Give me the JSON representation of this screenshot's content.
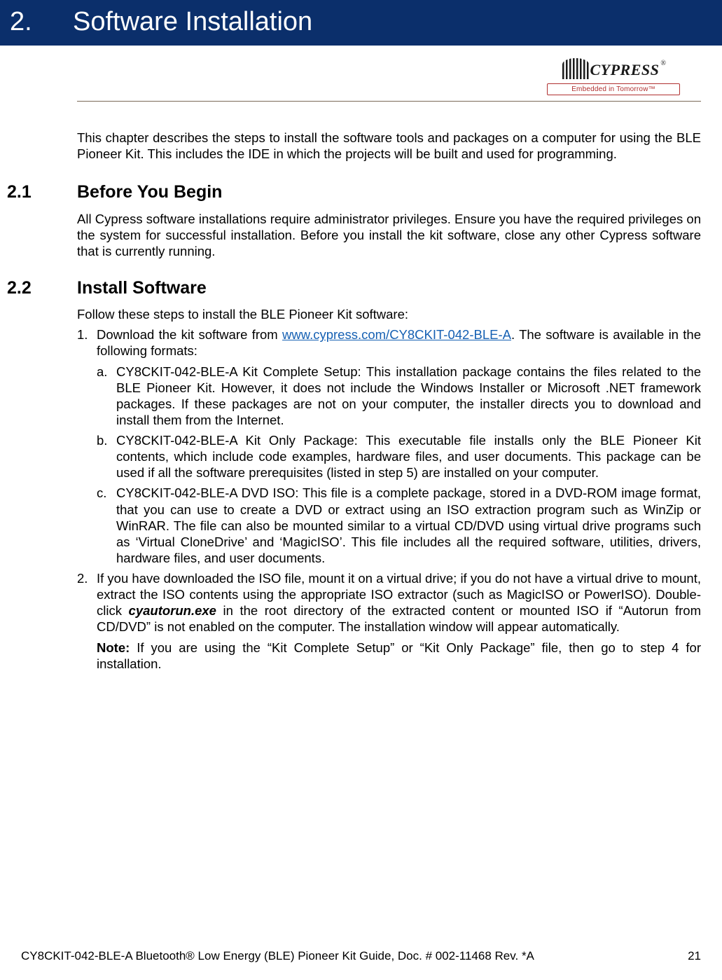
{
  "header": {
    "chapter_number": "2.",
    "chapter_title": "Software Installation"
  },
  "logo": {
    "name": "CYPRESS",
    "reg": "®",
    "tagline": "Embedded in Tomorrow™"
  },
  "intro": "This chapter describes the steps to install the software tools and packages on a computer for using the BLE Pioneer Kit. This includes the IDE in which the projects will be built and used for programming.",
  "sections": {
    "s1": {
      "num": "2.1",
      "title": "Before You Begin",
      "body": "All Cypress software installations require administrator privileges. Ensure you have the required privileges on the system for successful installation. Before you install the kit software, close any other Cypress software that is currently running."
    },
    "s2": {
      "num": "2.2",
      "title": "Install Software",
      "follow": "Follow these steps to install the BLE Pioneer Kit software:",
      "step1": {
        "marker": "1.",
        "pre": "Download the kit software from ",
        "link": "www.cypress.com/CY8CKIT-042-BLE-A",
        "post": ". The software is available in the following formats:",
        "a": {
          "marker": "a.",
          "text": "CY8CKIT-042-BLE-A Kit Complete Setup: This installation package contains the files related to the BLE Pioneer Kit. However, it does not include the Windows Installer or Microsoft .NET framework packages. If these packages are not on your computer, the installer directs you to download and install them from the Internet."
        },
        "b": {
          "marker": "b.",
          "text": "CY8CKIT-042-BLE-A Kit Only Package: This executable file installs only the BLE Pioneer Kit contents, which include code examples, hardware files, and user documents. This package can be used if all the software prerequisites (listed in step 5) are installed on your computer."
        },
        "c": {
          "marker": "c.",
          "text": "CY8CKIT-042-BLE-A DVD ISO: This file is a complete package, stored in a DVD-ROM image format, that you can use to create a DVD or extract using an ISO extraction program such as WinZip or WinRAR. The file can also be mounted similar to a virtual CD/DVD using virtual drive programs such as ‘Virtual CloneDrive’ and ‘MagicISO’. This file includes all the required software, utilities, drivers, hardware files, and user documents."
        }
      },
      "step2": {
        "marker": "2.",
        "pre": "If you have downloaded the ISO file, mount it on a virtual drive; if you do not have a virtual drive to mount, extract the ISO contents using the appropriate ISO extractor (such as MagicISO or PowerISO). Double-click ",
        "exe": "cyautorun.exe",
        "post": " in the root directory of the extracted content or mounted ISO if “Autorun from CD/DVD” is not enabled on the computer. The installation window will appear automatically.",
        "note_label": "Note:",
        "note": " If you are using the “Kit Complete Setup” or “Kit Only Package” file, then go to step 4 for installation."
      }
    }
  },
  "footer": {
    "doc": "CY8CKIT-042-BLE-A Bluetooth® Low Energy (BLE) Pioneer Kit Guide, Doc. # 002-11468 Rev. *A",
    "page": "21"
  }
}
